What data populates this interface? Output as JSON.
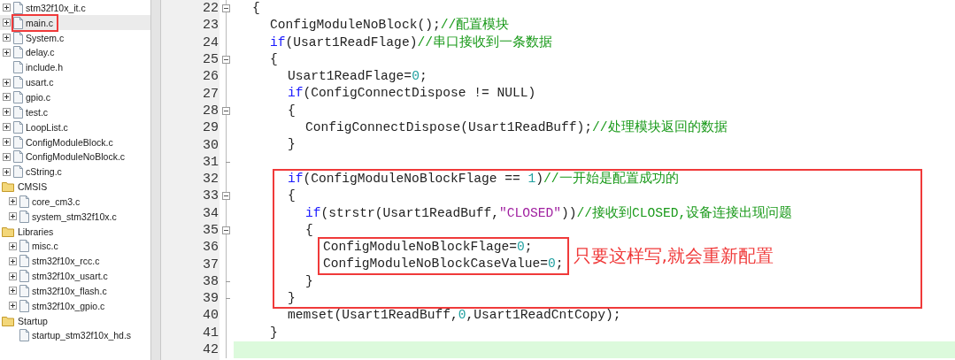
{
  "project_tree": [
    {
      "kind": "file",
      "label": "stm32f10x_it.c",
      "expandable": true,
      "selected": false,
      "annotated": false
    },
    {
      "kind": "file",
      "label": "main.c",
      "expandable": true,
      "selected": true,
      "annotated": true
    },
    {
      "kind": "file",
      "label": "System.c",
      "expandable": true,
      "selected": false,
      "annotated": false
    },
    {
      "kind": "file",
      "label": "delay.c",
      "expandable": true,
      "selected": false,
      "annotated": false
    },
    {
      "kind": "file",
      "label": "include.h",
      "expandable": false,
      "selected": false,
      "annotated": false
    },
    {
      "kind": "file",
      "label": "usart.c",
      "expandable": true,
      "selected": false,
      "annotated": false
    },
    {
      "kind": "file",
      "label": "gpio.c",
      "expandable": true,
      "selected": false,
      "annotated": false
    },
    {
      "kind": "file",
      "label": "test.c",
      "expandable": true,
      "selected": false,
      "annotated": false
    },
    {
      "kind": "file",
      "label": "LoopList.c",
      "expandable": true,
      "selected": false,
      "annotated": false
    },
    {
      "kind": "file",
      "label": "ConfigModuleBlock.c",
      "expandable": true,
      "selected": false,
      "annotated": false
    },
    {
      "kind": "file",
      "label": "ConfigModuleNoBlock.c",
      "expandable": true,
      "selected": false,
      "annotated": false
    },
    {
      "kind": "file",
      "label": "cString.c",
      "expandable": true,
      "selected": false,
      "annotated": false
    },
    {
      "kind": "folder",
      "label": "CMSIS",
      "children": [
        {
          "kind": "file",
          "label": "core_cm3.c",
          "expandable": true,
          "selected": false,
          "annotated": false
        },
        {
          "kind": "file",
          "label": "system_stm32f10x.c",
          "expandable": true,
          "selected": false,
          "annotated": false
        }
      ]
    },
    {
      "kind": "folder",
      "label": "Libraries",
      "children": [
        {
          "kind": "file",
          "label": "misc.c",
          "expandable": true,
          "selected": false,
          "annotated": false
        },
        {
          "kind": "file",
          "label": "stm32f10x_rcc.c",
          "expandable": true,
          "selected": false,
          "annotated": false
        },
        {
          "kind": "file",
          "label": "stm32f10x_usart.c",
          "expandable": true,
          "selected": false,
          "annotated": false
        },
        {
          "kind": "file",
          "label": "stm32f10x_flash.c",
          "expandable": true,
          "selected": false,
          "annotated": false
        },
        {
          "kind": "file",
          "label": "stm32f10x_gpio.c",
          "expandable": true,
          "selected": false,
          "annotated": false
        }
      ]
    },
    {
      "kind": "folder",
      "label": "Startup",
      "children": [
        {
          "kind": "file",
          "label": "startup_stm32f10x_hd.s",
          "expandable": false,
          "selected": false,
          "annotated": false
        }
      ]
    }
  ],
  "editor": {
    "lines": [
      {
        "kind": "line",
        "number": "22",
        "fold_toggle": true,
        "current": false,
        "tokens": [
          {
            "kind": "plain",
            "text": "{"
          }
        ],
        "children": [
          {
            "kind": "line",
            "number": "23",
            "current": false,
            "tokens": [
              {
                "kind": "plain",
                "text": "ConfigModuleNoBlock();"
              },
              {
                "kind": "comment",
                "text": "//配置模块"
              }
            ]
          },
          {
            "kind": "line",
            "number": "24",
            "current": false,
            "tokens": [
              {
                "kind": "keyword",
                "text": "if"
              },
              {
                "kind": "plain",
                "text": "(Usart1ReadFlage)"
              },
              {
                "kind": "comment",
                "text": "//串口接收到一条数据"
              }
            ]
          },
          {
            "kind": "line",
            "number": "25",
            "fold_toggle": true,
            "current": false,
            "tokens": [
              {
                "kind": "plain",
                "text": "{"
              }
            ],
            "children": [
              {
                "kind": "line",
                "number": "26",
                "current": false,
                "tokens": [
                  {
                    "kind": "plain",
                    "text": "Usart1ReadFlage="
                  },
                  {
                    "kind": "number",
                    "text": "0"
                  },
                  {
                    "kind": "plain",
                    "text": ";"
                  }
                ]
              },
              {
                "kind": "line",
                "number": "27",
                "current": false,
                "tokens": [
                  {
                    "kind": "keyword",
                    "text": "if"
                  },
                  {
                    "kind": "plain",
                    "text": "(ConfigConnectDispose != NULL)"
                  }
                ]
              },
              {
                "kind": "line",
                "number": "28",
                "fold_toggle": true,
                "current": false,
                "tokens": [
                  {
                    "kind": "plain",
                    "text": "{"
                  }
                ],
                "children": [
                  {
                    "kind": "line",
                    "number": "29",
                    "current": false,
                    "tokens": [
                      {
                        "kind": "plain",
                        "text": "ConfigConnectDispose(Usart1ReadBuff);"
                      },
                      {
                        "kind": "comment",
                        "text": "//处理模块返回的数据"
                      }
                    ]
                  }
                ]
              },
              {
                "kind": "line",
                "number": "30",
                "current": false,
                "tokens": [
                  {
                    "kind": "plain",
                    "text": "}"
                  }
                ]
              },
              {
                "kind": "line",
                "number": "31",
                "fold_end": true,
                "current": false
              },
              {
                "kind": "box",
                "lines": [
                  {
                    "kind": "line",
                    "number": "32",
                    "current": false,
                    "tokens": [
                      {
                        "kind": "keyword",
                        "text": "if"
                      },
                      {
                        "kind": "plain",
                        "text": "(ConfigModuleNoBlockFlage == "
                      },
                      {
                        "kind": "number",
                        "text": "1"
                      },
                      {
                        "kind": "plain",
                        "text": ")"
                      },
                      {
                        "kind": "comment",
                        "text": "//一开始是配置成功的"
                      }
                    ]
                  },
                  {
                    "kind": "line",
                    "number": "33",
                    "fold_toggle": true,
                    "current": false,
                    "tokens": [
                      {
                        "kind": "plain",
                        "text": "{"
                      }
                    ],
                    "children": [
                      {
                        "kind": "line",
                        "number": "34",
                        "current": false,
                        "tokens": [
                          {
                            "kind": "keyword",
                            "text": "if"
                          },
                          {
                            "kind": "plain",
                            "text": "(strstr(Usart1ReadBuff,"
                          },
                          {
                            "kind": "string",
                            "text": "\"CLOSED\""
                          },
                          {
                            "kind": "plain",
                            "text": "))"
                          },
                          {
                            "kind": "comment",
                            "text": "//接收到CLOSED,设备连接出现问题"
                          }
                        ]
                      },
                      {
                        "kind": "line",
                        "number": "35",
                        "fold_toggle": true,
                        "current": false,
                        "tokens": [
                          {
                            "kind": "plain",
                            "text": "{"
                          }
                        ],
                        "children": [
                          {
                            "kind": "box",
                            "note": "只要这样写,就会重新配置",
                            "lines": [
                              {
                                "kind": "line",
                                "number": "36",
                                "current": false,
                                "tokens": [
                                  {
                                    "kind": "plain",
                                    "text": "ConfigModuleNoBlockFlage="
                                  },
                                  {
                                    "kind": "number",
                                    "text": "0"
                                  },
                                  {
                                    "kind": "plain",
                                    "text": ";"
                                  }
                                ]
                              },
                              {
                                "kind": "line",
                                "number": "37",
                                "current": false,
                                "tokens": [
                                  {
                                    "kind": "plain",
                                    "text": "ConfigModuleNoBlockCaseValue="
                                  },
                                  {
                                    "kind": "number",
                                    "text": "0"
                                  },
                                  {
                                    "kind": "plain",
                                    "text": ";"
                                  }
                                ]
                              }
                            ]
                          }
                        ]
                      },
                      {
                        "kind": "line",
                        "number": "38",
                        "fold_end": true,
                        "current": false,
                        "tokens": [
                          {
                            "kind": "plain",
                            "text": "}"
                          }
                        ]
                      }
                    ]
                  },
                  {
                    "kind": "line",
                    "number": "39",
                    "fold_end": true,
                    "current": false,
                    "tokens": [
                      {
                        "kind": "plain",
                        "text": "}"
                      }
                    ]
                  }
                ]
              },
              {
                "kind": "line",
                "number": "40",
                "current": false,
                "tokens": [
                  {
                    "kind": "plain",
                    "text": "memset(Usart1ReadBuff,"
                  },
                  {
                    "kind": "number",
                    "text": "0"
                  },
                  {
                    "kind": "plain",
                    "text": ",Usart1ReadCntCopy);"
                  }
                ]
              }
            ]
          },
          {
            "kind": "line",
            "number": "41",
            "current": false,
            "tokens": [
              {
                "kind": "plain",
                "text": "}"
              }
            ]
          }
        ]
      },
      {
        "kind": "line",
        "number": "42",
        "current": true
      }
    ]
  }
}
